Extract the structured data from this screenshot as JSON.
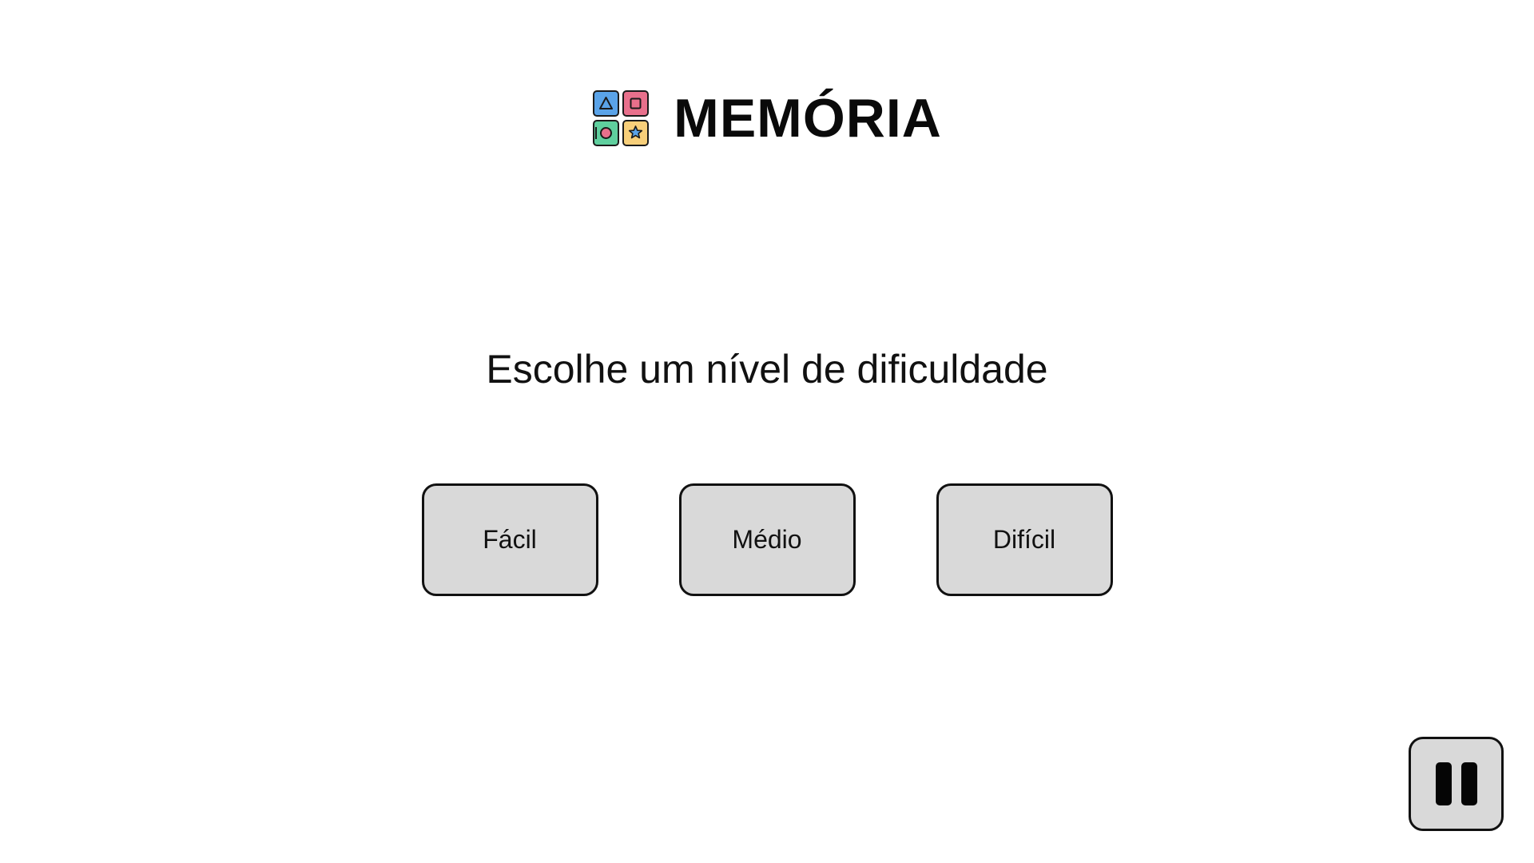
{
  "header": {
    "title": "MEMÓRIA",
    "logo_icon": "memory-cards-logo-icon",
    "logo_colors": {
      "triangle_tile": "#5aa3e8",
      "square_tile": "#e8708c",
      "circle_tile": "#5fcf9e",
      "star_tile": "#f7cf7a"
    }
  },
  "main": {
    "prompt": "Escolhe um nível de dificuldade",
    "difficulties": [
      {
        "label": "Fácil"
      },
      {
        "label": "Médio"
      },
      {
        "label": "Difícil"
      }
    ]
  },
  "controls": {
    "pause_icon": "pause-icon"
  },
  "colors": {
    "background": "#ffffff",
    "button_fill": "#d9d9d9",
    "button_border": "#111111",
    "text": "#111111"
  }
}
